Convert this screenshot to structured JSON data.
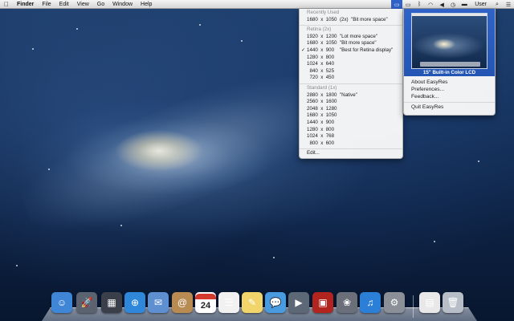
{
  "menubar": {
    "apple_icon": "apple-logo-icon",
    "items": [
      "Finder",
      "File",
      "Edit",
      "View",
      "Go",
      "Window",
      "Help"
    ],
    "status_icons": [
      "easyres-display-icon",
      "airplay-icon",
      "bluetooth-icon",
      "wifi-icon",
      "volume-icon",
      "time-machine-icon",
      "battery-icon"
    ],
    "user": "User",
    "right_icons": [
      "spotlight-icon",
      "notification-center-icon"
    ]
  },
  "resolution_menu": {
    "sections": [
      {
        "heading": "Recently Used",
        "rows": [
          {
            "text": "1680  x  1050  (2x)  \"Bit more space\"",
            "checked": false
          }
        ]
      },
      {
        "heading": "Retina (2x)",
        "rows": [
          {
            "text": "1920  x  1200  \"Lot more space\"",
            "checked": false
          },
          {
            "text": "1680  x  1050  \"Bit more space\"",
            "checked": false
          },
          {
            "text": "1440  x  900    \"Best for Retina display\"",
            "checked": true
          },
          {
            "text": "1280  x  800",
            "checked": false
          },
          {
            "text": "1024  x  640",
            "checked": false
          },
          {
            "text": "  840  x  525",
            "checked": false
          },
          {
            "text": "  720  x  450",
            "checked": false
          }
        ]
      },
      {
        "heading": "Standard (1x)",
        "rows": [
          {
            "text": "2880  x  1800  \"Native\"",
            "checked": false
          },
          {
            "text": "2560  x  1600",
            "checked": false
          },
          {
            "text": "2048  x  1280",
            "checked": false
          },
          {
            "text": "1680  x  1050",
            "checked": false
          },
          {
            "text": "1440  x  900",
            "checked": false
          },
          {
            "text": "1280  x  800",
            "checked": false
          },
          {
            "text": "1024  x  768",
            "checked": false
          },
          {
            "text": "  800  x  600",
            "checked": false
          }
        ]
      }
    ],
    "edit_label": "Edit...",
    "check_mark": "✓"
  },
  "easyres_panel": {
    "display_label": "15\" Built-in Color LCD",
    "items": [
      "About EasyRes",
      "Preferences...",
      "Feedback..."
    ],
    "quit_label": "Quit EasyRes"
  },
  "dock": {
    "apps": [
      {
        "name": "finder-icon",
        "glyph": "☺",
        "color": "#3f86d6"
      },
      {
        "name": "launchpad-icon",
        "glyph": "🚀",
        "color": "#5b6270"
      },
      {
        "name": "mission-control-icon",
        "glyph": "▦",
        "color": "#3b3f4a"
      },
      {
        "name": "safari-icon",
        "glyph": "⊕",
        "color": "#2e87d8"
      },
      {
        "name": "mail-icon",
        "glyph": "✉",
        "color": "#5d8fd1"
      },
      {
        "name": "contacts-icon",
        "glyph": "@",
        "color": "#b88b52"
      },
      {
        "name": "calendar-icon",
        "glyph": "24",
        "color": "#ffffff"
      },
      {
        "name": "reminders-icon",
        "glyph": "☰",
        "color": "#f1f1f1"
      },
      {
        "name": "notes-icon",
        "glyph": "✎",
        "color": "#f1d56a"
      },
      {
        "name": "messages-icon",
        "glyph": "💬",
        "color": "#4a9ae0"
      },
      {
        "name": "facetime-icon",
        "glyph": "▶",
        "color": "#5d6877"
      },
      {
        "name": "photo-booth-icon",
        "glyph": "▣",
        "color": "#b2251f"
      },
      {
        "name": "iphoto-icon",
        "glyph": "❀",
        "color": "#6b6f7a"
      },
      {
        "name": "itunes-icon",
        "glyph": "♫",
        "color": "#2c7fd7"
      },
      {
        "name": "system-preferences-icon",
        "glyph": "⚙",
        "color": "#8a8f98"
      },
      {
        "name": "preview-icon",
        "glyph": "▤",
        "color": "#e8e8e8"
      },
      {
        "name": "trash-icon",
        "glyph": "🗑",
        "color": "#b8bec8"
      }
    ]
  }
}
